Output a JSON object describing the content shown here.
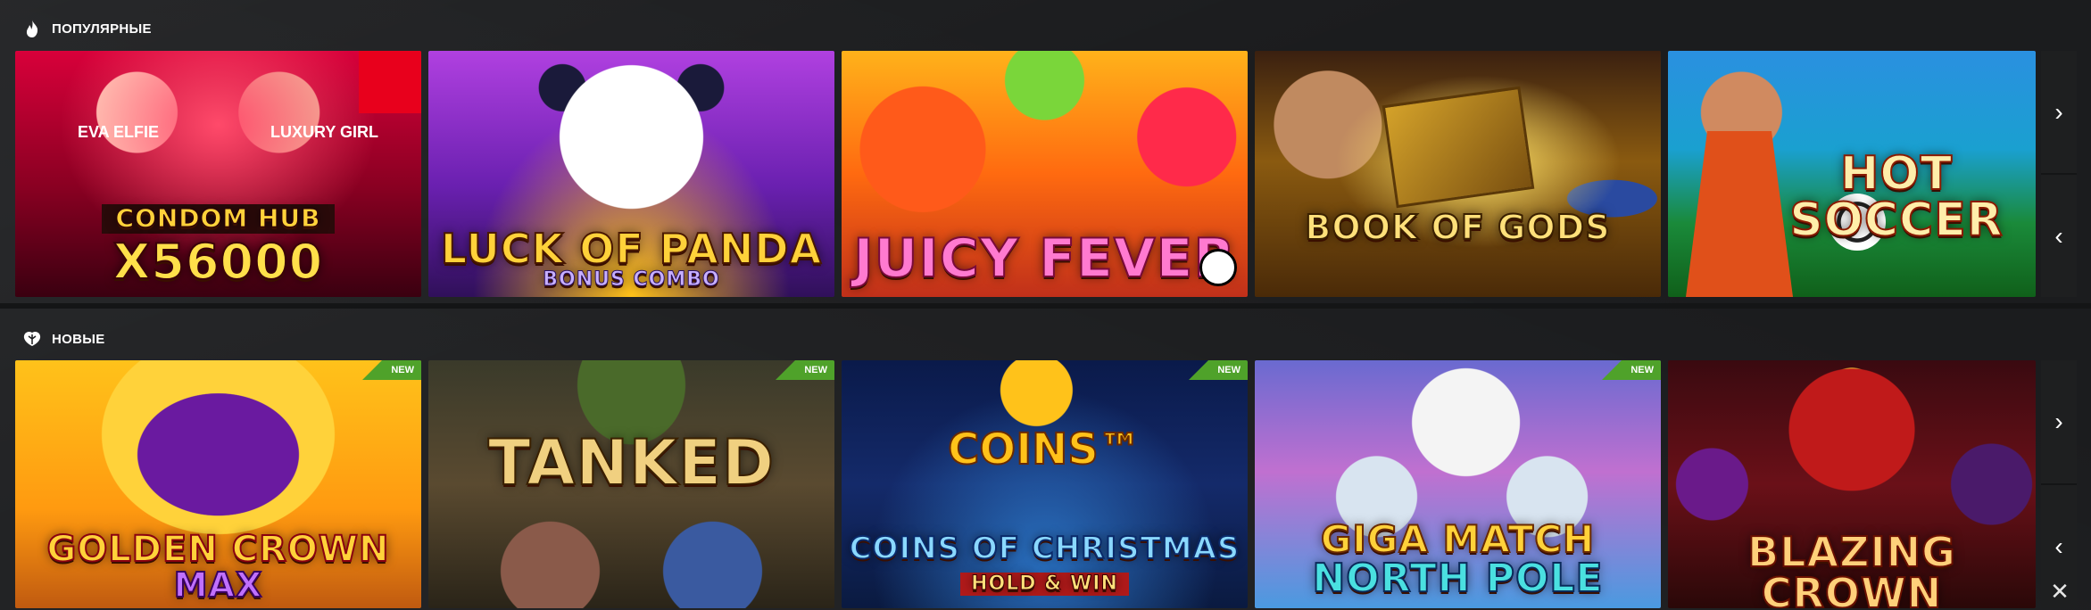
{
  "sections": [
    {
      "title": "ПОПУЛЯРНЫЕ",
      "icon": "fire-icon",
      "games": [
        {
          "title": "CONDOM HUB",
          "subtitle": "X56000",
          "badge": ""
        },
        {
          "title": "LUCK OF PANDA",
          "subtitle": "BONUS COMBO",
          "badge": ""
        },
        {
          "title": "JUICY FEVER",
          "subtitle": "",
          "badge": ""
        },
        {
          "title": "BOOK OF GODS",
          "subtitle": "",
          "badge": ""
        },
        {
          "title": "HOT SOCCER",
          "subtitle": "",
          "badge": ""
        }
      ]
    },
    {
      "title": "НОВЫЕ",
      "icon": "leaf-icon",
      "games": [
        {
          "title": "GOLDEN CROWN",
          "subtitle": "MAX",
          "badge": "NEW"
        },
        {
          "title": "TANKED",
          "subtitle": "",
          "badge": "NEW"
        },
        {
          "title": "COINS OF CHRISTMAS",
          "subtitle": "HOLD & WIN",
          "badge": "NEW"
        },
        {
          "title": "GIGA MATCH",
          "subtitle": "NORTH POLE",
          "badge": "NEW"
        },
        {
          "title": "BLAZING CROWN",
          "subtitle": "",
          "badge": ""
        }
      ]
    }
  ],
  "nav": {
    "next": "›",
    "prev": "‹"
  },
  "close": "✕",
  "tile_extras": {
    "tile_0_0_labels": [
      "EVA ELFIE",
      "LUXURY GIRL"
    ],
    "tile_1_2_text": "COINS™"
  }
}
